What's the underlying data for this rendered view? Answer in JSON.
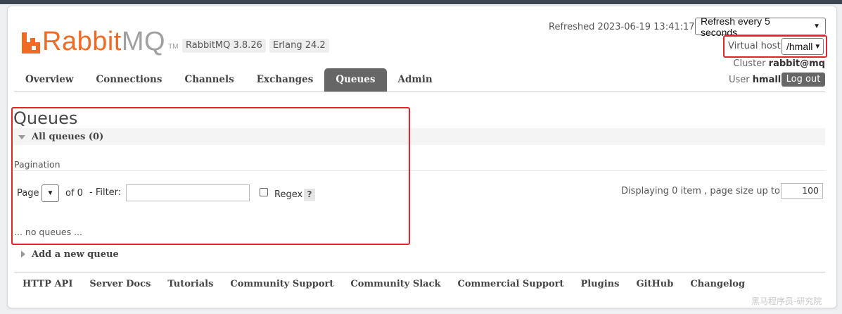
{
  "header": {
    "logo_rabbit": "Rabbit",
    "logo_mq": "MQ",
    "logo_tm": "TM",
    "version_badge": "RabbitMQ 3.8.26",
    "erlang_badge": "Erlang 24.2",
    "refreshed_text": "Refreshed 2023-06-19 13:41:17",
    "refresh_select_value": "Refresh every 5 seconds",
    "virtual_host_label": "Virtual host",
    "virtual_host_value": "/hmall",
    "cluster_label": "Cluster",
    "cluster_value": "rabbit@mq",
    "user_label": "User",
    "user_value": "hmall",
    "logout_label": "Log out"
  },
  "tabs": [
    {
      "label": "Overview",
      "active": false
    },
    {
      "label": "Connections",
      "active": false
    },
    {
      "label": "Channels",
      "active": false
    },
    {
      "label": "Exchanges",
      "active": false
    },
    {
      "label": "Queues",
      "active": true
    },
    {
      "label": "Admin",
      "active": false
    }
  ],
  "main": {
    "page_title": "Queues",
    "section_title": "All queues (0)",
    "pagination_label": "Pagination",
    "page_label": "Page",
    "page_select_value": "",
    "of_label": "of 0",
    "filter_label": "- Filter:",
    "filter_value": "",
    "regex_label": "Regex",
    "help_label": "?",
    "displaying_text": "Displaying 0 item , page size up to:",
    "page_size_value": "100",
    "empty_text": "... no queues ...",
    "add_queue_label": "Add a new queue"
  },
  "footer": {
    "links": [
      "HTTP API",
      "Server Docs",
      "Tutorials",
      "Community Support",
      "Community Slack",
      "Commercial Support",
      "Plugins",
      "GitHub",
      "Changelog"
    ]
  },
  "watermark": "黑马程序员-研究院",
  "colors": {
    "brand_orange": "#f16a23",
    "highlight_red": "#e0262b",
    "active_tab_bg": "#666666"
  },
  "icons": {
    "section_toggle": "triangle-down-icon",
    "add_queue_toggle": "triangle-right-icon",
    "select_chevron": "chevron-down-icon"
  }
}
